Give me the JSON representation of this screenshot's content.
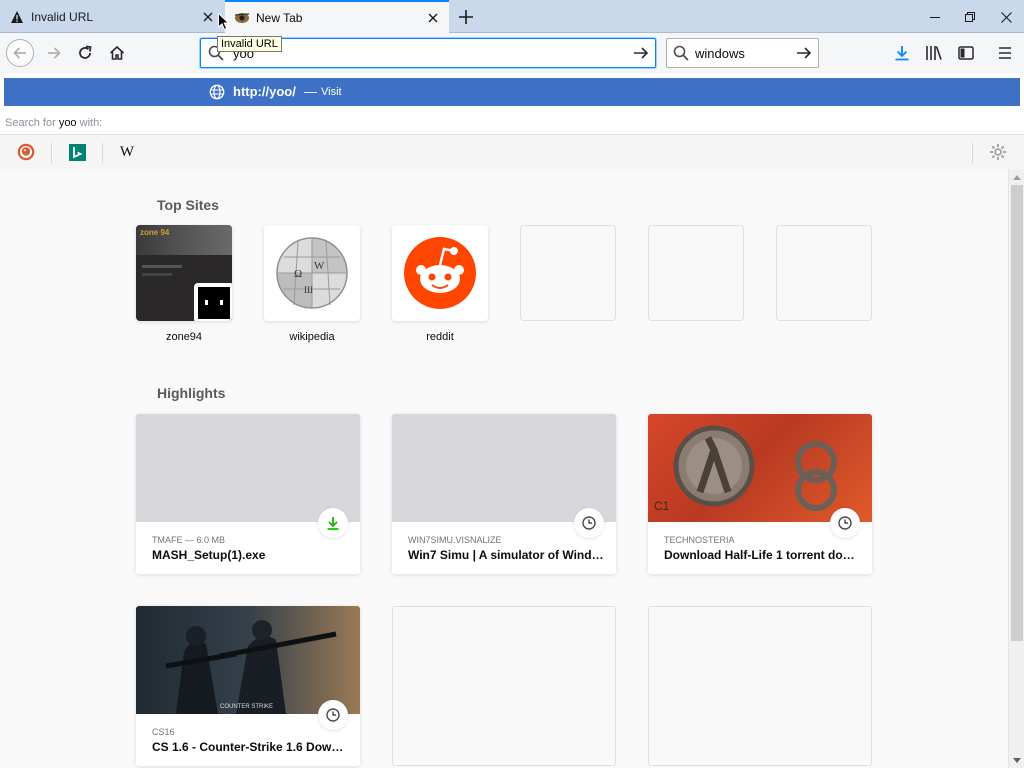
{
  "tabs": [
    {
      "label": "Invalid URL",
      "icon": "warning-icon"
    },
    {
      "label": "New Tab",
      "icon": "page-favicon"
    }
  ],
  "tooltip": "Invalid URL",
  "urlbar": {
    "value": "yoo"
  },
  "searchbar": {
    "value": "windows"
  },
  "autocomplete": {
    "url": "http://yoo/",
    "separator": "—",
    "action": "Visit"
  },
  "search_for": {
    "prefix": "Search for ",
    "query": "yoo",
    "suffix": " with:"
  },
  "engines": [
    "duckduckgo-icon",
    "bing-icon",
    "wikipedia-icon"
  ],
  "engine_wiki_letter": "W",
  "colors": {
    "accent": "#0a84ff",
    "autocomplete_bg": "#3e71c6",
    "download_green": "#12bc00",
    "reddit": "#ff4500"
  },
  "top_sites": {
    "title": "Top Sites",
    "items": [
      {
        "label": "zone94"
      },
      {
        "label": "wikipedia"
      },
      {
        "label": "reddit"
      },
      {
        "label": ""
      },
      {
        "label": ""
      },
      {
        "label": ""
      }
    ]
  },
  "zone_thumb_text": "zone 94",
  "highlights": {
    "title": "Highlights",
    "cards": [
      {
        "context": "TMAFE — 6.0 MB",
        "title": "MASH_Setup(1).exe",
        "badge": "download-icon"
      },
      {
        "context": "WIN7SIMU.VISNALIZE",
        "title": "Win7 Simu | A simulator of Windows 7",
        "badge": "clock-icon"
      },
      {
        "context": "TECHNOSTERIA",
        "title": "Download Half-Life 1 torrent download",
        "badge": "clock-icon"
      },
      {
        "context": "CS16",
        "title": "CS 1.6 - Counter-Strike 1.6 Download",
        "badge": "clock-icon"
      }
    ]
  },
  "hl_thumb_c1": "C1",
  "cs_thumb_text": "COUNTER STRIKE"
}
